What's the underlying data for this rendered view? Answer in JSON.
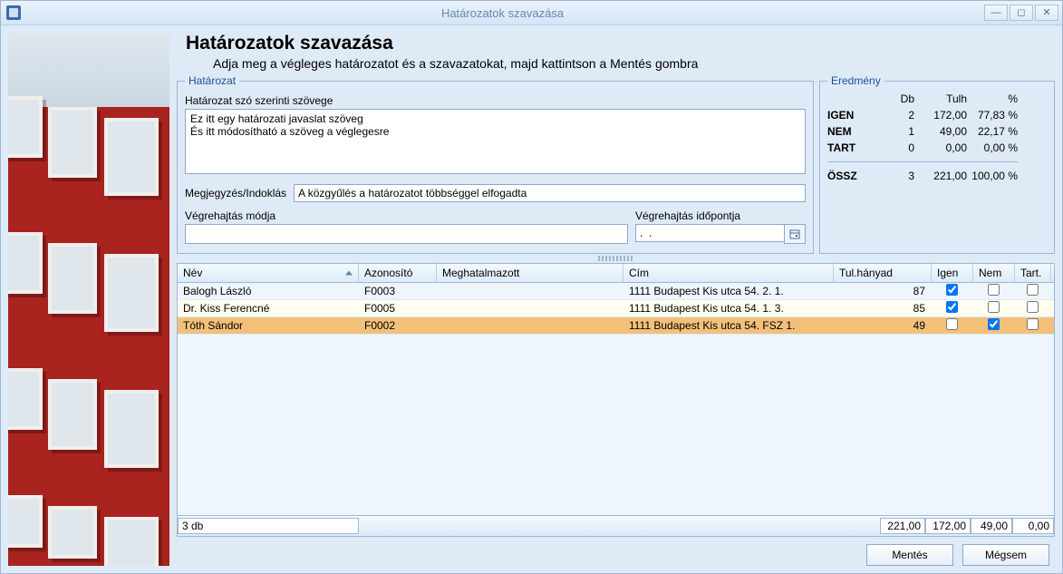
{
  "window": {
    "title": "Határozatok szavazása"
  },
  "header": {
    "title": "Határozatok szavazása",
    "subtitle": "Adja meg a végleges határozatot és a szavazatokat, majd kattintson a Mentés gombra"
  },
  "hatarozat": {
    "legend": "Határozat",
    "text_label": "Határozat szó szerinti szövege",
    "text_value": "Ez itt egy határozati javaslat szöveg\nÉs itt módosítható a szöveg a véglegesre",
    "notes_label": "Megjegyzés/Indoklás",
    "notes_value": "A közgyűlés a határozatot többséggel elfogadta",
    "exec_mode_label": "Végrehajtás módja",
    "exec_mode_value": "",
    "exec_date_label": "Végrehajtás időpontja",
    "exec_date_value": ".  ."
  },
  "eredmeny": {
    "legend": "Eredmény",
    "head_db": "Db",
    "head_tulh": "Tulh",
    "head_pct": "%",
    "rows": [
      {
        "label": "IGEN",
        "db": "2",
        "tulh": "172,00",
        "pct": "77,83 %"
      },
      {
        "label": "NEM",
        "db": "1",
        "tulh": "49,00",
        "pct": "22,17 %"
      },
      {
        "label": "TART",
        "db": "0",
        "tulh": "0,00",
        "pct": "0,00 %"
      }
    ],
    "sum": {
      "label": "ÖSSZ",
      "db": "3",
      "tulh": "221,00",
      "pct": "100,00 %"
    }
  },
  "table": {
    "cols": {
      "name": "Név",
      "id": "Azonosító",
      "proxy": "Meghatalmazott",
      "addr": "Cím",
      "share": "Tul.hányad",
      "yes": "Igen",
      "no": "Nem",
      "abs": "Tart."
    },
    "rows": [
      {
        "name": "Balogh László",
        "id": "F0003",
        "proxy": "",
        "addr": "1111 Budapest Kis utca 54.  2. 1.",
        "share": "87",
        "yes": true,
        "no": false,
        "abs": false
      },
      {
        "name": "Dr. Kiss Ferencné",
        "id": "F0005",
        "proxy": "",
        "addr": "1111 Budapest Kis utca 54.  1. 3.",
        "share": "85",
        "yes": true,
        "no": false,
        "abs": false
      },
      {
        "name": "Tóth Sándor",
        "id": "F0002",
        "proxy": "",
        "addr": "1111 Budapest Kis utca 54.  FSZ 1.",
        "share": "49",
        "yes": false,
        "no": true,
        "abs": false
      }
    ],
    "footer": {
      "count": "3 db",
      "sum_share": "221,00",
      "sum_yes": "172,00",
      "sum_no": "49,00",
      "sum_abs": "0,00"
    }
  },
  "buttons": {
    "save": "Mentés",
    "cancel": "Mégsem"
  }
}
